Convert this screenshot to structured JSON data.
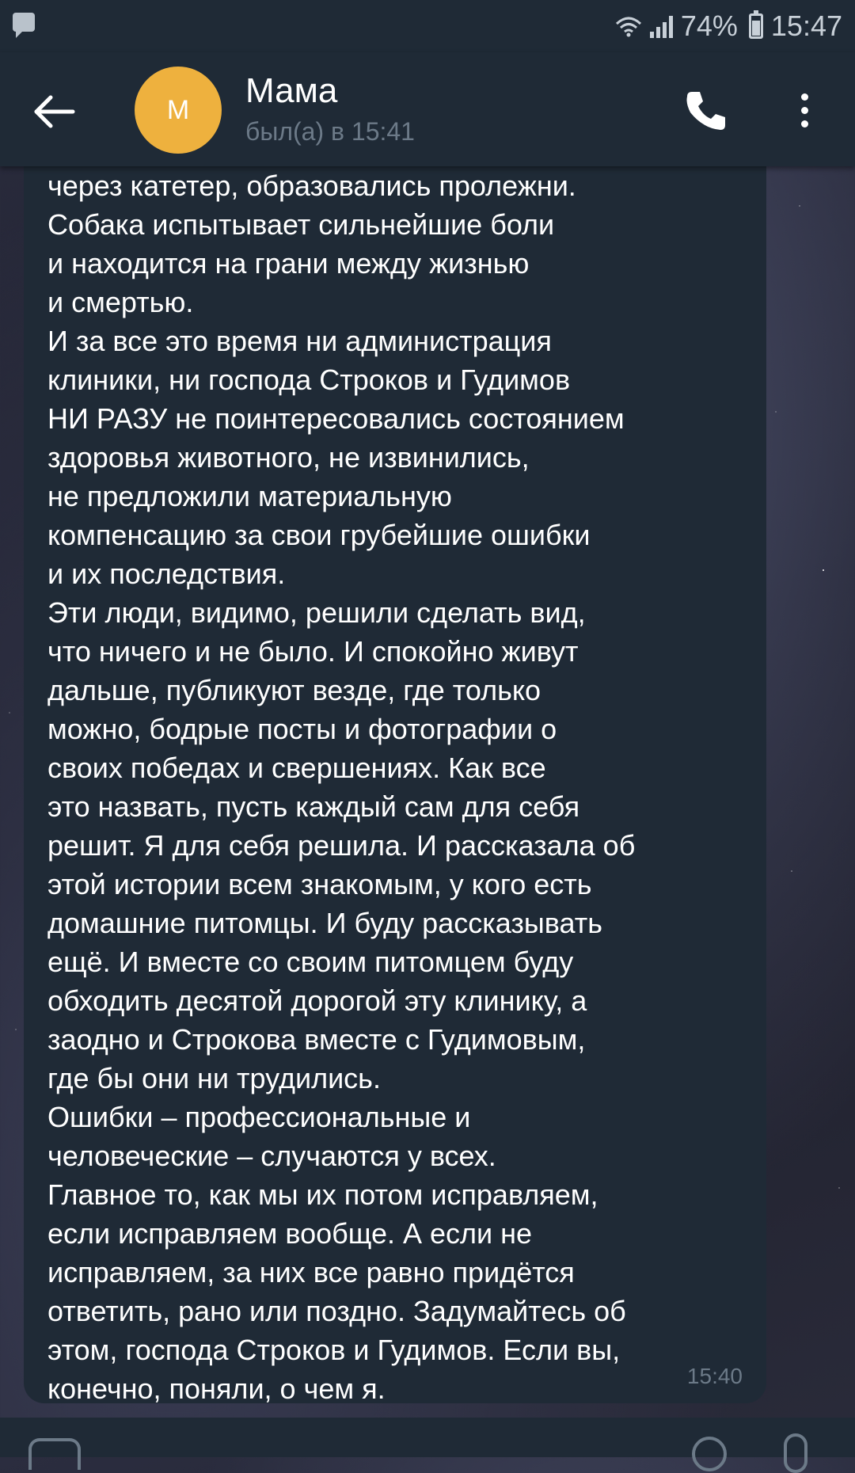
{
  "status_bar": {
    "battery": "74%",
    "time": "15:47",
    "battery_level": 0.74
  },
  "header": {
    "avatar_letter": "М",
    "title": "Мама",
    "subtitle": "был(а) в 15:41",
    "avatar_color": "#eeb13e",
    "icons": [
      "back-arrow-icon",
      "phone-icon",
      "more-vertical-icon"
    ]
  },
  "message": {
    "partial_first_line": "через катетер, образовались пролежни.",
    "text": "Собака испытывает сильнейшие боли\nи находится на грани между жизнью\nи смертью.\nИ за все это время ни администрация\nклиники, ни господа Строков и Гудимов\nНИ РАЗУ не поинтересовались состоянием\nздоровья животного, не извинились,\nне предложили материальную\nкомпенсацию за свои грубейшие ошибки\nи их последствия.\nЭти люди, видимо, решили сделать вид,\nчто ничего и не было. И спокойно живут\nдальше, публикуют везде, где только\nможно, бодрые посты и фотографии о\nсвоих победах и свершениях. Как все\nэто назвать, пусть каждый сам для себя\nрешит. Я для себя решила. И рассказала об\nэтой истории всем знакомым, у кого есть\nдомашние питомцы. И буду рассказывать\nещё. И вместе со своим питомцем буду\nобходить десятой дорогой эту клинику, а\nзаодно и Строкова вместе с Гудимовым,\nгде бы они ни трудились.\nОшибки – профессиональные и\nчеловеческие – случаются у всех.\nГлавное то, как мы их потом исправляем,\nесли исправляем вообще. А если не\nисправляем, за них все равно придётся\nответить, рано или поздно. Задумайтесь об\nэтом, господа Строков и Гудимов. Если вы,\nконечно, поняли, о чем я.",
    "time": "15:40"
  },
  "colors": {
    "header_bg": "#1f2a36",
    "bubble_bg": "#1f2a36",
    "muted_text": "#6c7a88"
  }
}
